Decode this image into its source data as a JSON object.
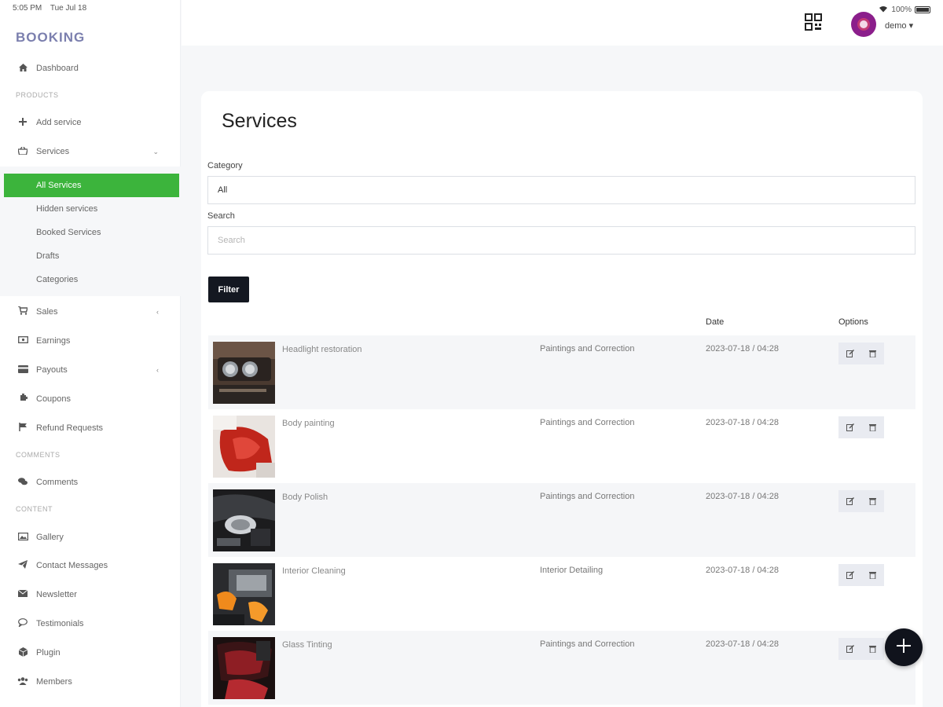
{
  "status": {
    "time": "5:05 PM",
    "date": "Tue Jul 18",
    "battery": "100%"
  },
  "brand": "BOOKING",
  "sidebar": {
    "dashboard": "Dashboard",
    "sections": {
      "products": "PRODUCTS",
      "comments": "COMMENTS",
      "content": "CONTENT"
    },
    "add_service": "Add service",
    "services": "Services",
    "services_sub": [
      "All Services",
      "Hidden services",
      "Booked Services",
      "Drafts",
      "Categories"
    ],
    "sales": "Sales",
    "earnings": "Earnings",
    "payouts": "Payouts",
    "coupons": "Coupons",
    "refund_requests": "Refund Requests",
    "comments": "Comments",
    "gallery": "Gallery",
    "contact_messages": "Contact Messages",
    "newsletter": "Newsletter",
    "testimonials": "Testimonials",
    "plugin": "Plugin",
    "members": "Members"
  },
  "topbar": {
    "user": "demo ▾"
  },
  "main": {
    "title": "Services",
    "category_label": "Category",
    "category_value": "All",
    "search_label": "Search",
    "search_placeholder": "Search",
    "filter_label": "Filter",
    "columns": {
      "date": "Date",
      "options": "Options"
    },
    "rows": [
      {
        "name": "Headlight restoration",
        "category": "Paintings and Correction",
        "date": "2023-07-18 / 04:28"
      },
      {
        "name": "Body painting",
        "category": "Paintings and Correction",
        "date": "2023-07-18 / 04:28"
      },
      {
        "name": "Body Polish",
        "category": "Paintings and Correction",
        "date": "2023-07-18 / 04:28"
      },
      {
        "name": "Interior Cleaning",
        "category": "Interior Detailing",
        "date": "2023-07-18 / 04:28"
      },
      {
        "name": "Glass Tinting",
        "category": "Paintings and Correction",
        "date": "2023-07-18 / 04:28"
      }
    ]
  },
  "colors": {
    "accent": "#3cb43c",
    "brand": "#7b7fae",
    "dark": "#141821"
  }
}
